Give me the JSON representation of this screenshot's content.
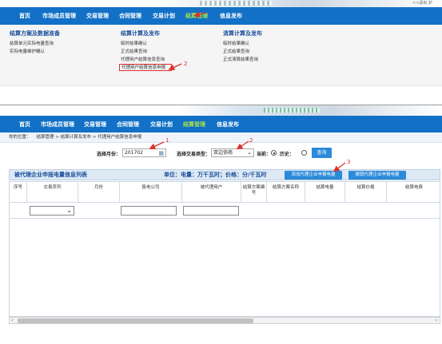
{
  "top": {
    "user_link": "<<退出 护",
    "nav": [
      "首页",
      "市场成员管理",
      "交易管理",
      "合同管理",
      "交易计划",
      "结算管理",
      "信息发布"
    ],
    "active_nav_index": 5,
    "menu": [
      {
        "title": "结算方案及数据准备",
        "items": [
          "结算单元实际电量查询",
          "实际电量维护确认"
        ]
      },
      {
        "title": "结算计算及发布",
        "items": [
          "临时结果确认",
          "正式结果查询",
          "代理用户结算信息查询",
          "代理用户结算信息申报"
        ]
      },
      {
        "title": "清算计算及发布",
        "items": [
          "临时结果确认",
          "正式结果查询",
          "正式清算结果查询"
        ]
      }
    ],
    "highlighted_item": "代理用户结算信息申报",
    "annotation": "2"
  },
  "bottom": {
    "nav": [
      "首页",
      "市场成员管理",
      "交易管理",
      "合同管理",
      "交易计划",
      "结算管理",
      "信息发布"
    ],
    "active_nav_index": 5,
    "breadcrumb": {
      "label": "你的位置：",
      "path": "结算管理 > 结算计算及发布 > 代理用户结算信息申报"
    },
    "filters": {
      "month_label": "选择月份：",
      "month_value": "201702",
      "type_label": "选择交易类型：",
      "type_value": "双边协商",
      "current_label": "当前：",
      "history_label": "历史：",
      "query_button": "查询"
    },
    "annotations": [
      "1",
      "2",
      "3"
    ],
    "table": {
      "title": "被代理企业申报电量信息列表",
      "unit": "单位：电量：万千瓦时；价格：分/千瓦时",
      "add_button": "添加代理企业申报电量",
      "revoke_button": "撤销代理企业申报电量",
      "columns": [
        "序号",
        "交易序列",
        "月份",
        "售电公司",
        "被代理用户",
        "结算方案编号",
        "结算方案名称",
        "结算电量",
        "结算价格",
        "结算电费"
      ]
    },
    "scroll": {
      "left_arrow": "‹",
      "right_arrow": "›"
    }
  },
  "colors": {
    "nav_blue": "#1271c6",
    "active_nav": "#a4e24a",
    "annotation_red": "#e0302b",
    "button_blue": "#2b8ad9"
  }
}
